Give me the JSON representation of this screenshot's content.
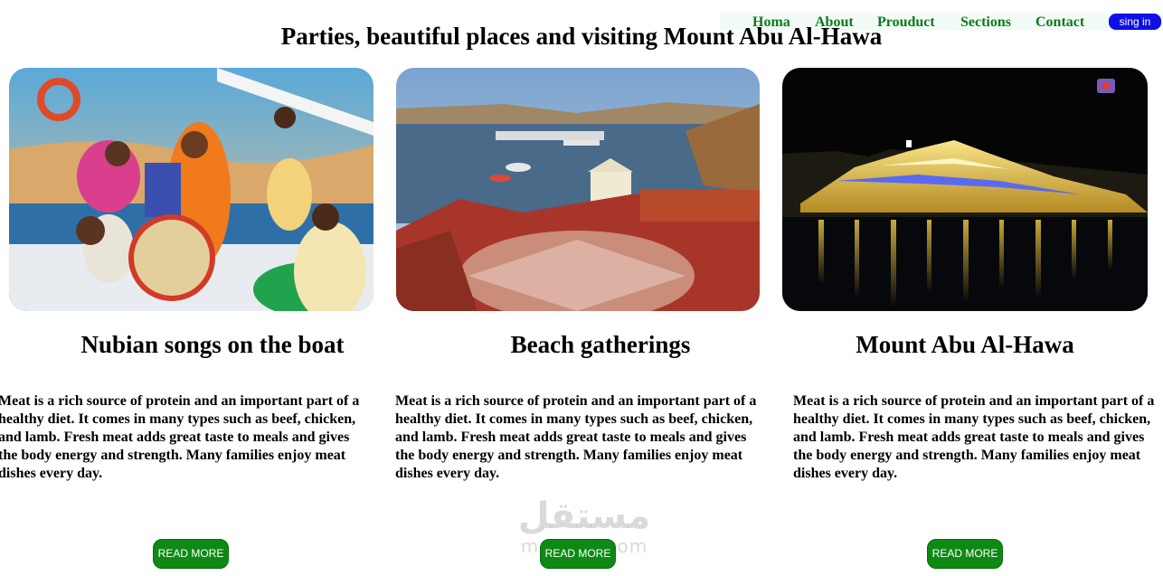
{
  "nav": {
    "items": [
      "Homa",
      "About",
      "Prouduct",
      "Sections",
      "Contact"
    ],
    "signin_label": "sing in"
  },
  "page": {
    "title": "Parties, beautiful places and visiting Mount Abu Al-Hawa"
  },
  "cards": [
    {
      "image": "nubian-boat-party-photo",
      "title": "Nubian songs on the boat",
      "text": "Meat is a rich source of protein and an important part of a healthy diet. It comes in many types such as beef, chicken, and lamb. Fresh meat adds great taste to meals and gives the body energy and strength. Many families enjoy meat dishes every day.",
      "button": "READ MORE"
    },
    {
      "image": "beach-gathering-photo",
      "title": "Beach gatherings",
      "text": "Meat is a rich source of protein and an important part of a healthy diet. It comes in many types such as beef, chicken, and lamb. Fresh meat adds great taste to meals and gives the body energy and strength. Many families enjoy meat dishes every day.",
      "button": "READ MORE"
    },
    {
      "image": "mount-abu-al-hawa-night-photo",
      "title": "Mount Abu Al-Hawa",
      "text": "Meat is a rich source of protein and an important part of a healthy diet. It comes in many types such as beef, chicken, and lamb. Fresh meat adds great taste to meals and gives the body energy and strength. Many families enjoy meat dishes every day.",
      "button": "READ MORE"
    }
  ],
  "watermark": {
    "arabic": "مستقل",
    "latin": "mostaql.com"
  },
  "colors": {
    "nav_link": "#0d7a1b",
    "signin_bg": "#0f0fe8",
    "button_bg": "#0e8a14"
  }
}
